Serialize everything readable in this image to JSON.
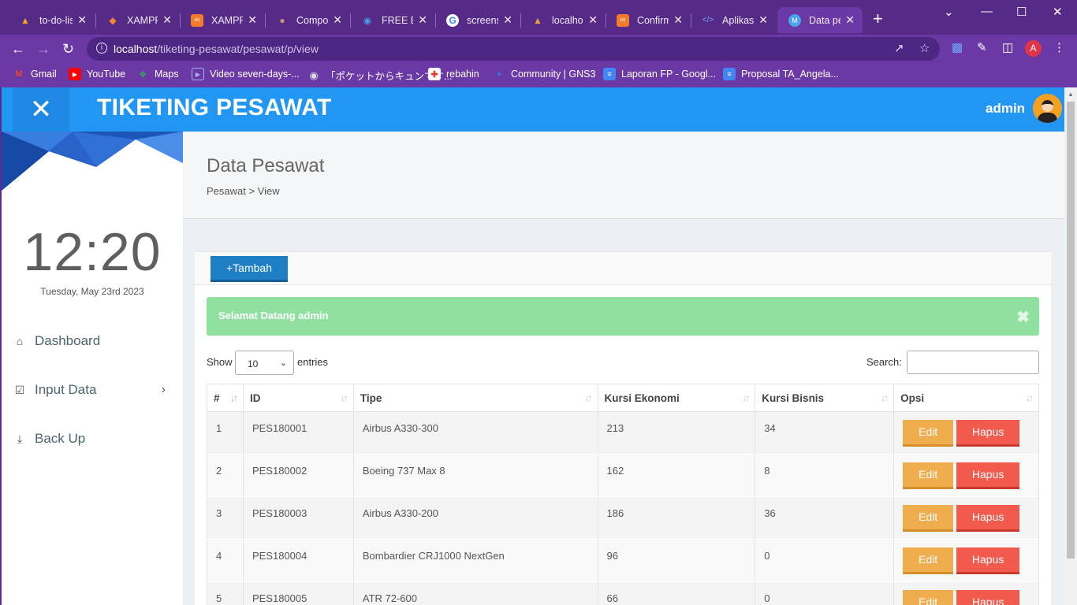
{
  "browser": {
    "tabs": [
      {
        "title": "to-do-lis",
        "icon": "firebase-icon",
        "color": "#f6a623"
      },
      {
        "title": "XAMPP ",
        "icon": "code-icon",
        "color": "#f08a24"
      },
      {
        "title": "XAMPP ",
        "icon": "xampp-icon",
        "color": "#f57b2a"
      },
      {
        "title": "Compos",
        "icon": "composer-icon",
        "color": "#c49a6c"
      },
      {
        "title": "FREE Bu",
        "icon": "globe-icon",
        "color": "#4b9ae8"
      },
      {
        "title": "screensh",
        "icon": "google-icon",
        "color": "#ffffff"
      },
      {
        "title": "localhos",
        "icon": "phpmyadmin-icon",
        "color": "#f0a030"
      },
      {
        "title": "Confirm",
        "icon": "xampp-icon",
        "color": "#f57b2a"
      },
      {
        "title": "Aplikasi",
        "icon": "code-icon",
        "color": "#6ea8ff"
      },
      {
        "title": "Data pe",
        "icon": "app-icon",
        "color": "#4aa3f0"
      }
    ],
    "url_host": "localhost",
    "url_path": "/tiketing-pesawat/pesawat/p/view",
    "profile_initial": "A",
    "bookmarks": [
      {
        "label": "Gmail",
        "icon": "gmail-icon",
        "color": "#ea4335"
      },
      {
        "label": "YouTube",
        "icon": "youtube-icon",
        "color": "#ff0000"
      },
      {
        "label": "Maps",
        "icon": "maps-icon",
        "color": "#34a853"
      },
      {
        "label": "Video seven-days-...",
        "icon": "video-icon",
        "color": "#4a7bd8"
      },
      {
        "label": "「ポケットからキュンです...",
        "icon": "globe-icon",
        "color": "#dddddd"
      },
      {
        "label": "rebahin",
        "icon": "site-icon",
        "color": "#e53935"
      },
      {
        "label": "Community | GNS3",
        "icon": "gns3-icon",
        "color": "#3b6fd6"
      },
      {
        "label": "Laporan FP - Googl...",
        "icon": "docs-icon",
        "color": "#4285f4"
      },
      {
        "label": "Proposal TA_Angela...",
        "icon": "docs-icon",
        "color": "#4285f4"
      }
    ]
  },
  "app": {
    "brand": "TIKETING PESAWAT",
    "user": "admin",
    "accent": "#2196f3"
  },
  "sidebar": {
    "clock": "12:20",
    "date": "Tuesday, May 23rd 2023",
    "items": [
      {
        "label": "Dashboard",
        "icon": "home-icon"
      },
      {
        "label": "Input Data",
        "icon": "check-square-icon"
      },
      {
        "label": "Back Up",
        "icon": "download-icon"
      }
    ]
  },
  "content": {
    "title": "Data Pesawat",
    "breadcrumb": "Pesawat > View",
    "add_button": "+Tambah",
    "alert": "Selamat Datang admin",
    "show_label": "Show",
    "entries_value": "10",
    "entries_label": "entries",
    "search_label": "Search:"
  },
  "table": {
    "columns": [
      "#",
      "ID",
      "Tipe",
      "Kursi Ekonomi",
      "Kursi Bisnis",
      "Opsi"
    ],
    "edit_label": "Edit",
    "delete_label": "Hapus",
    "rows": [
      [
        "1",
        "PES180001",
        "Airbus A330-300",
        "213",
        "34"
      ],
      [
        "2",
        "PES180002",
        "Boeing 737 Max 8",
        "162",
        "8"
      ],
      [
        "3",
        "PES180003",
        "Airbus A330-200",
        "186",
        "36"
      ],
      [
        "4",
        "PES180004",
        "Bombardier CRJ1000 NextGen",
        "96",
        "0"
      ],
      [
        "5",
        "PES180005",
        "ATR 72-600",
        "66",
        "0"
      ]
    ]
  }
}
